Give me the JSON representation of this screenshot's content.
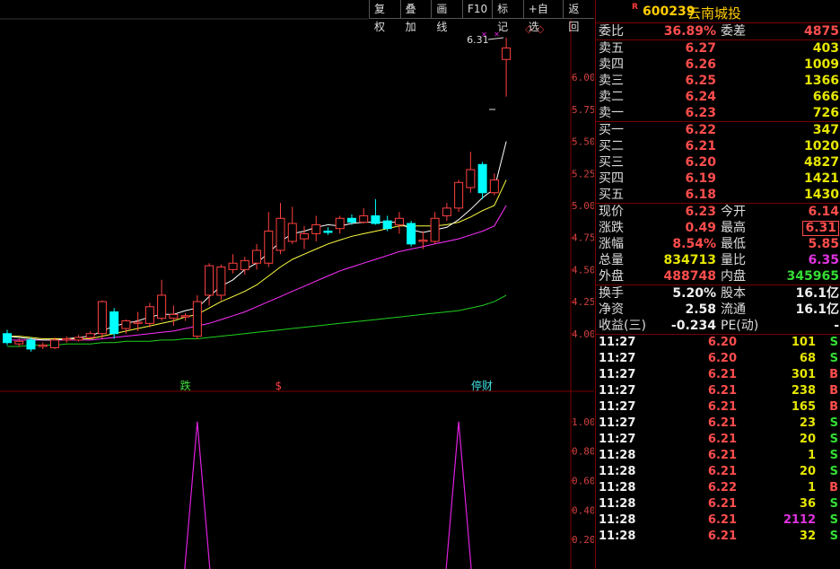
{
  "toolbar": {
    "buttons": [
      "复权",
      "叠加",
      "画线",
      "F10",
      "标记",
      "+自选",
      "返回"
    ]
  },
  "stock": {
    "r_mark": "R",
    "code": "600239",
    "name": "云南城投"
  },
  "price_axis": [
    "6.00",
    "5.75",
    "5.50",
    "5.25",
    "5.00",
    "4.75",
    "4.50",
    "4.25",
    "4.00"
  ],
  "indicator_axis": [
    "1.00",
    "0.80",
    "0.60",
    "0.40",
    "0.20"
  ],
  "chart_labels": {
    "high_mark": "6.31",
    "event1": "跌",
    "event2": "$",
    "event3": "停财"
  },
  "chart_data": {
    "type": "candlestick",
    "ylim": [
      3.55,
      6.45
    ],
    "candles": [
      {
        "o": 4.0,
        "h": 4.03,
        "l": 3.91,
        "c": 3.93
      },
      {
        "o": 3.92,
        "h": 3.96,
        "l": 3.9,
        "c": 3.94
      },
      {
        "o": 3.95,
        "h": 3.97,
        "l": 3.86,
        "c": 3.88
      },
      {
        "o": 3.9,
        "h": 3.93,
        "l": 3.88,
        "c": 3.91
      },
      {
        "o": 3.89,
        "h": 3.97,
        "l": 3.88,
        "c": 3.95
      },
      {
        "o": 3.95,
        "h": 3.98,
        "l": 3.93,
        "c": 3.96
      },
      {
        "o": 3.95,
        "h": 3.99,
        "l": 3.94,
        "c": 3.97
      },
      {
        "o": 3.97,
        "h": 4.02,
        "l": 3.96,
        "c": 4.0
      },
      {
        "o": 4.0,
        "h": 4.26,
        "l": 3.96,
        "c": 4.25
      },
      {
        "o": 4.17,
        "h": 4.2,
        "l": 3.96,
        "c": 4.0
      },
      {
        "o": 4.04,
        "h": 4.11,
        "l": 4.0,
        "c": 4.1
      },
      {
        "o": 4.08,
        "h": 4.17,
        "l": 4.02,
        "c": 4.09
      },
      {
        "o": 4.08,
        "h": 4.24,
        "l": 4.05,
        "c": 4.21
      },
      {
        "o": 4.12,
        "h": 4.42,
        "l": 4.1,
        "c": 4.3
      },
      {
        "o": 4.12,
        "h": 4.22,
        "l": 4.06,
        "c": 4.15
      },
      {
        "o": 4.13,
        "h": 4.16,
        "l": 4.1,
        "c": 4.14
      },
      {
        "o": 3.98,
        "h": 4.3,
        "l": 3.96,
        "c": 4.25
      },
      {
        "o": 4.3,
        "h": 4.55,
        "l": 4.22,
        "c": 4.53
      },
      {
        "o": 4.3,
        "h": 4.54,
        "l": 4.26,
        "c": 4.52
      },
      {
        "o": 4.5,
        "h": 4.62,
        "l": 4.47,
        "c": 4.55
      },
      {
        "o": 4.5,
        "h": 4.6,
        "l": 4.46,
        "c": 4.57
      },
      {
        "o": 4.55,
        "h": 4.7,
        "l": 4.5,
        "c": 4.65
      },
      {
        "o": 4.55,
        "h": 4.95,
        "l": 4.52,
        "c": 4.8
      },
      {
        "o": 4.65,
        "h": 5.02,
        "l": 4.62,
        "c": 4.9
      },
      {
        "o": 4.72,
        "h": 4.99,
        "l": 4.7,
        "c": 4.86
      },
      {
        "o": 4.74,
        "h": 4.84,
        "l": 4.66,
        "c": 4.78
      },
      {
        "o": 4.78,
        "h": 4.92,
        "l": 4.72,
        "c": 4.85
      },
      {
        "o": 4.8,
        "h": 4.83,
        "l": 4.77,
        "c": 4.79
      },
      {
        "o": 4.82,
        "h": 4.92,
        "l": 4.78,
        "c": 4.9
      },
      {
        "o": 4.9,
        "h": 4.93,
        "l": 4.85,
        "c": 4.87
      },
      {
        "o": 4.87,
        "h": 4.98,
        "l": 4.86,
        "c": 4.92
      },
      {
        "o": 4.92,
        "h": 5.05,
        "l": 4.85,
        "c": 4.86
      },
      {
        "o": 4.88,
        "h": 4.92,
        "l": 4.8,
        "c": 4.82
      },
      {
        "o": 4.85,
        "h": 4.95,
        "l": 4.78,
        "c": 4.9
      },
      {
        "o": 4.86,
        "h": 4.88,
        "l": 4.68,
        "c": 4.7
      },
      {
        "o": 4.72,
        "h": 4.8,
        "l": 4.66,
        "c": 4.73
      },
      {
        "o": 4.72,
        "h": 4.95,
        "l": 4.7,
        "c": 4.9
      },
      {
        "o": 4.92,
        "h": 5.02,
        "l": 4.88,
        "c": 4.98
      },
      {
        "o": 4.98,
        "h": 5.2,
        "l": 4.95,
        "c": 5.18
      },
      {
        "o": 5.14,
        "h": 5.42,
        "l": 5.1,
        "c": 5.28
      },
      {
        "o": 5.32,
        "h": 5.34,
        "l": 5.05,
        "c": 5.1
      },
      {
        "o": 5.1,
        "h": 5.25,
        "l": 5.08,
        "c": 5.2
      },
      {
        "o": 6.14,
        "h": 6.31,
        "l": 5.85,
        "c": 6.23
      }
    ],
    "ma5": [
      3.98,
      3.97,
      3.96,
      3.95,
      3.95,
      3.96,
      3.97,
      3.98,
      4.02,
      4.06,
      4.08,
      4.1,
      4.13,
      4.15,
      4.15,
      4.18,
      4.2,
      4.29,
      4.37,
      4.42,
      4.5,
      4.55,
      4.63,
      4.72,
      4.78,
      4.8,
      4.83,
      4.85,
      4.84,
      4.86,
      4.87,
      4.87,
      4.87,
      4.87,
      4.81,
      4.79,
      4.81,
      4.83,
      4.89,
      4.97,
      5.06,
      5.13,
      5.5
    ],
    "ma10": [
      3.98,
      3.98,
      3.97,
      3.96,
      3.96,
      3.96,
      3.96,
      3.96,
      3.98,
      4.0,
      4.02,
      4.04,
      4.06,
      4.08,
      4.1,
      4.13,
      4.15,
      4.2,
      4.25,
      4.29,
      4.33,
      4.38,
      4.45,
      4.52,
      4.58,
      4.62,
      4.66,
      4.7,
      4.73,
      4.76,
      4.78,
      4.8,
      4.82,
      4.84,
      4.84,
      4.84,
      4.84,
      4.85,
      4.87,
      4.91,
      4.96,
      5.0,
      5.2
    ],
    "ma20": [
      3.95,
      3.95,
      3.95,
      3.95,
      3.95,
      3.95,
      3.95,
      3.95,
      3.96,
      3.97,
      3.98,
      3.99,
      4.0,
      4.01,
      4.02,
      4.04,
      4.06,
      4.08,
      4.11,
      4.14,
      4.17,
      4.21,
      4.25,
      4.29,
      4.33,
      4.37,
      4.41,
      4.45,
      4.49,
      4.52,
      4.55,
      4.58,
      4.61,
      4.64,
      4.66,
      4.68,
      4.7,
      4.72,
      4.74,
      4.77,
      4.8,
      4.84,
      5.0
    ],
    "ma60": [
      3.9,
      3.9,
      3.91,
      3.91,
      3.91,
      3.92,
      3.92,
      3.92,
      3.93,
      3.93,
      3.94,
      3.94,
      3.94,
      3.95,
      3.95,
      3.96,
      3.96,
      3.97,
      3.98,
      3.99,
      4.0,
      4.01,
      4.02,
      4.03,
      4.04,
      4.05,
      4.06,
      4.07,
      4.08,
      4.09,
      4.1,
      4.11,
      4.12,
      4.13,
      4.14,
      4.15,
      4.16,
      4.17,
      4.18,
      4.2,
      4.22,
      4.25,
      4.3
    ],
    "indicator": {
      "ylim": [
        0,
        1.2
      ],
      "spikes": [
        {
          "index": 16,
          "value": 1.0
        },
        {
          "index": 38,
          "value": 1.0
        }
      ]
    }
  },
  "quote": {
    "weibi": {
      "label": "委比",
      "value": "36.89%",
      "label2": "委差",
      "value2": "4875"
    },
    "sell": [
      {
        "label": "卖五",
        "price": "6.27",
        "vol": "403"
      },
      {
        "label": "卖四",
        "price": "6.26",
        "vol": "1009"
      },
      {
        "label": "卖三",
        "price": "6.25",
        "vol": "1366"
      },
      {
        "label": "卖二",
        "price": "6.24",
        "vol": "666"
      },
      {
        "label": "卖一",
        "price": "6.23",
        "vol": "726"
      }
    ],
    "buy": [
      {
        "label": "买一",
        "price": "6.22",
        "vol": "347"
      },
      {
        "label": "买二",
        "price": "6.21",
        "vol": "1020"
      },
      {
        "label": "买三",
        "price": "6.20",
        "vol": "4827"
      },
      {
        "label": "买四",
        "price": "6.19",
        "vol": "1421"
      },
      {
        "label": "买五",
        "price": "6.18",
        "vol": "1430"
      }
    ],
    "stats": [
      {
        "l1": "现价",
        "v1": "6.23",
        "l2": "今开",
        "v2": "6.14"
      },
      {
        "l1": "涨跌",
        "v1": "0.49",
        "l2": "最高",
        "v2": "6.31"
      },
      {
        "l1": "涨幅",
        "v1": "8.54%",
        "l2": "最低",
        "v2": "5.85"
      },
      {
        "l1": "总量",
        "v1": "834713",
        "l2": "量比",
        "v2": "6.35"
      },
      {
        "l1": "外盘",
        "v1": "488748",
        "l2": "内盘",
        "v2": "345965"
      }
    ],
    "fund": [
      {
        "l1": "换手",
        "v1": "5.20%",
        "l2": "股本",
        "v2": "16.1亿"
      },
      {
        "l1": "净资",
        "v1": "2.58",
        "l2": "流通",
        "v2": "16.1亿"
      },
      {
        "l1": "收益(三)",
        "v1": "-0.234",
        "l2": "PE(动)",
        "v2": "-"
      }
    ]
  },
  "trades": [
    {
      "time": "11:27",
      "price": "6.20",
      "vol": "101",
      "bs": "S"
    },
    {
      "time": "11:27",
      "price": "6.20",
      "vol": "68",
      "bs": "S"
    },
    {
      "time": "11:27",
      "price": "6.21",
      "vol": "301",
      "bs": "B"
    },
    {
      "time": "11:27",
      "price": "6.21",
      "vol": "238",
      "bs": "B"
    },
    {
      "time": "11:27",
      "price": "6.21",
      "vol": "165",
      "bs": "B"
    },
    {
      "time": "11:27",
      "price": "6.21",
      "vol": "23",
      "bs": "S"
    },
    {
      "time": "11:27",
      "price": "6.21",
      "vol": "20",
      "bs": "S"
    },
    {
      "time": "11:28",
      "price": "6.21",
      "vol": "1",
      "bs": "S"
    },
    {
      "time": "11:28",
      "price": "6.21",
      "vol": "20",
      "bs": "S"
    },
    {
      "time": "11:28",
      "price": "6.22",
      "vol": "1",
      "bs": "B"
    },
    {
      "time": "11:28",
      "price": "6.21",
      "vol": "36",
      "bs": "S"
    },
    {
      "time": "11:28",
      "price": "6.21",
      "vol": "2112",
      "bs": "S"
    },
    {
      "time": "11:28",
      "price": "6.21",
      "vol": "32",
      "bs": "S"
    }
  ],
  "colors": {
    "up": "#ff4040",
    "down": "#00ffff",
    "ma5": "#ffffff",
    "ma10": "#ffff40",
    "ma20": "#ff30ff",
    "ma60": "#20d020",
    "border": "#7a0000",
    "indicator": "#e020e0"
  }
}
